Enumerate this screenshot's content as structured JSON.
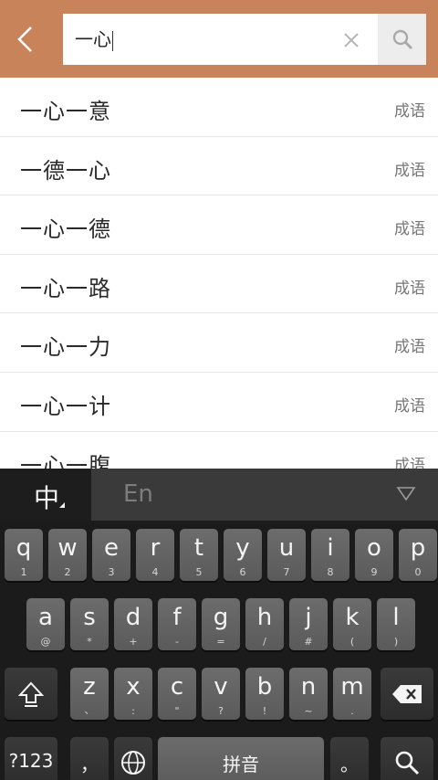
{
  "search": {
    "query": "一心"
  },
  "results": [
    {
      "word": "一心一意",
      "type": "成语"
    },
    {
      "word": "一德一心",
      "type": "成语"
    },
    {
      "word": "一心一德",
      "type": "成语"
    },
    {
      "word": "一心一路",
      "type": "成语"
    },
    {
      "word": "一心一力",
      "type": "成语"
    },
    {
      "word": "一心一计",
      "type": "成语"
    },
    {
      "word": "一心一腹",
      "type": "成语"
    }
  ],
  "keyboard": {
    "lang_zh": "中",
    "lang_en": "En",
    "row1": [
      {
        "k": "q",
        "s": "1"
      },
      {
        "k": "w",
        "s": "2"
      },
      {
        "k": "e",
        "s": "3"
      },
      {
        "k": "r",
        "s": "4"
      },
      {
        "k": "t",
        "s": "5"
      },
      {
        "k": "y",
        "s": "6"
      },
      {
        "k": "u",
        "s": "7"
      },
      {
        "k": "i",
        "s": "8"
      },
      {
        "k": "o",
        "s": "9"
      },
      {
        "k": "p",
        "s": "0"
      }
    ],
    "row2": [
      {
        "k": "a",
        "s": "@"
      },
      {
        "k": "s",
        "s": "*"
      },
      {
        "k": "d",
        "s": "+"
      },
      {
        "k": "f",
        "s": "-"
      },
      {
        "k": "g",
        "s": "="
      },
      {
        "k": "h",
        "s": "/"
      },
      {
        "k": "j",
        "s": "#"
      },
      {
        "k": "k",
        "s": "("
      },
      {
        "k": "l",
        "s": ")"
      }
    ],
    "row3": [
      {
        "k": "z",
        "s": "、"
      },
      {
        "k": "x",
        "s": ":"
      },
      {
        "k": "c",
        "s": "\""
      },
      {
        "k": "v",
        "s": "?"
      },
      {
        "k": "b",
        "s": "!"
      },
      {
        "k": "n",
        "s": "~"
      },
      {
        "k": "m",
        "s": "."
      }
    ],
    "num_key": "?123",
    "comma_key": "，",
    "space_key": "拼音",
    "period_key": "。"
  },
  "colors": {
    "topbar": "#c8835a",
    "key": "#626262",
    "keyboard_bg": "#1b1b1b"
  }
}
